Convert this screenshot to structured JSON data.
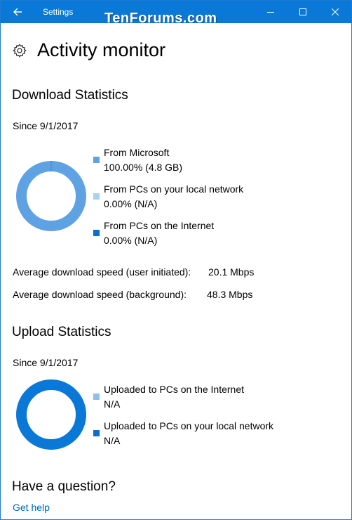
{
  "window": {
    "title": "Settings",
    "watermark": "TenForums.com"
  },
  "page": {
    "title": "Activity monitor"
  },
  "download": {
    "heading": "Download Statistics",
    "since": "Since 9/1/2017",
    "legend": [
      {
        "label": "From Microsoft",
        "value": "100.00%  (4.8 GB)",
        "color": "#5ea2e3"
      },
      {
        "label": "From PCs on your local network",
        "value": "0.00%  (N/A)",
        "color": "#a9d1f0"
      },
      {
        "label": "From PCs on the Internet",
        "value": "0.00%  (N/A)",
        "color": "#0a6fce"
      }
    ],
    "avg_user_label": "Average download speed (user initiated):",
    "avg_user_value": "20.1 Mbps",
    "avg_bg_label": "Average download speed (background):",
    "avg_bg_value": "48.3 Mbps",
    "donut_color": "#5ea2e3"
  },
  "upload": {
    "heading": "Upload Statistics",
    "since": "Since 9/1/2017",
    "legend": [
      {
        "label": "Uploaded to PCs on the Internet",
        "value": "N/A",
        "color": "#8ec0ea"
      },
      {
        "label": "Uploaded to PCs on your local network",
        "value": "N/A",
        "color": "#0a6fce"
      }
    ],
    "donut_color": "#0a78d7"
  },
  "help": {
    "heading": "Have a question?",
    "link": "Get help"
  },
  "icons": {
    "back": "back-arrow-icon",
    "minimize": "minimize-icon",
    "maximize": "maximize-icon",
    "close": "close-icon",
    "settings": "gear-icon"
  }
}
